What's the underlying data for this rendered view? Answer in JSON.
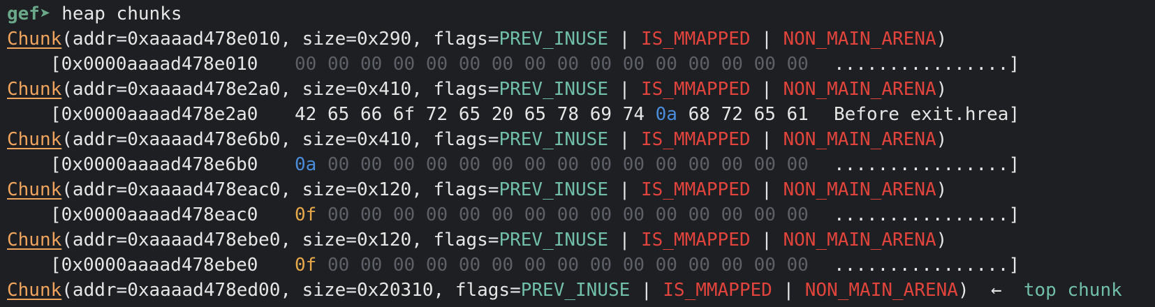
{
  "prompt": "gef➤",
  "command": "heap chunks",
  "chunks": [
    {
      "keyword": "Chunk",
      "addr": "0xaaaad478e010",
      "size": "0x290",
      "flags": [
        "PREV_INUSE",
        "IS_MMAPPED",
        "NON_MAIN_ARENA"
      ],
      "dump_addr": "[0x0000aaaad478e010",
      "bytes": [
        {
          "v": "00",
          "style": "dim"
        },
        {
          "v": "00",
          "style": "dim"
        },
        {
          "v": "00",
          "style": "dim"
        },
        {
          "v": "00",
          "style": "dim"
        },
        {
          "v": "00",
          "style": "dim"
        },
        {
          "v": "00",
          "style": "dim"
        },
        {
          "v": "00",
          "style": "dim"
        },
        {
          "v": "00",
          "style": "dim"
        },
        {
          "v": "00",
          "style": "dim"
        },
        {
          "v": "00",
          "style": "dim"
        },
        {
          "v": "00",
          "style": "dim"
        },
        {
          "v": "00",
          "style": "dim"
        },
        {
          "v": "00",
          "style": "dim"
        },
        {
          "v": "00",
          "style": "dim"
        },
        {
          "v": "00",
          "style": "dim"
        },
        {
          "v": "00",
          "style": "dim"
        }
      ],
      "ascii": "................]"
    },
    {
      "keyword": "Chunk",
      "addr": "0xaaaad478e2a0",
      "size": "0x410",
      "flags": [
        "PREV_INUSE",
        "IS_MMAPPED",
        "NON_MAIN_ARENA"
      ],
      "dump_addr": "[0x0000aaaad478e2a0",
      "bytes": [
        {
          "v": "42",
          "style": "txt"
        },
        {
          "v": "65",
          "style": "txt"
        },
        {
          "v": "66",
          "style": "txt"
        },
        {
          "v": "6f",
          "style": "txt"
        },
        {
          "v": "72",
          "style": "txt"
        },
        {
          "v": "65",
          "style": "txt"
        },
        {
          "v": "20",
          "style": "txt"
        },
        {
          "v": "65",
          "style": "txt"
        },
        {
          "v": "78",
          "style": "txt"
        },
        {
          "v": "69",
          "style": "txt"
        },
        {
          "v": "74",
          "style": "txt"
        },
        {
          "v": "0a",
          "style": "hl-blue"
        },
        {
          "v": "68",
          "style": "txt"
        },
        {
          "v": "72",
          "style": "txt"
        },
        {
          "v": "65",
          "style": "txt"
        },
        {
          "v": "61",
          "style": "txt"
        }
      ],
      "ascii": "Before exit.hrea]"
    },
    {
      "keyword": "Chunk",
      "addr": "0xaaaad478e6b0",
      "size": "0x410",
      "flags": [
        "PREV_INUSE",
        "IS_MMAPPED",
        "NON_MAIN_ARENA"
      ],
      "dump_addr": "[0x0000aaaad478e6b0",
      "bytes": [
        {
          "v": "0a",
          "style": "hl-blue"
        },
        {
          "v": "00",
          "style": "dim"
        },
        {
          "v": "00",
          "style": "dim"
        },
        {
          "v": "00",
          "style": "dim"
        },
        {
          "v": "00",
          "style": "dim"
        },
        {
          "v": "00",
          "style": "dim"
        },
        {
          "v": "00",
          "style": "dim"
        },
        {
          "v": "00",
          "style": "dim"
        },
        {
          "v": "00",
          "style": "dim"
        },
        {
          "v": "00",
          "style": "dim"
        },
        {
          "v": "00",
          "style": "dim"
        },
        {
          "v": "00",
          "style": "dim"
        },
        {
          "v": "00",
          "style": "dim"
        },
        {
          "v": "00",
          "style": "dim"
        },
        {
          "v": "00",
          "style": "dim"
        },
        {
          "v": "00",
          "style": "dim"
        }
      ],
      "ascii": "................]"
    },
    {
      "keyword": "Chunk",
      "addr": "0xaaaad478eac0",
      "size": "0x120",
      "flags": [
        "PREV_INUSE",
        "IS_MMAPPED",
        "NON_MAIN_ARENA"
      ],
      "dump_addr": "[0x0000aaaad478eac0",
      "bytes": [
        {
          "v": "0f",
          "style": "hl-orange"
        },
        {
          "v": "00",
          "style": "dim"
        },
        {
          "v": "00",
          "style": "dim"
        },
        {
          "v": "00",
          "style": "dim"
        },
        {
          "v": "00",
          "style": "dim"
        },
        {
          "v": "00",
          "style": "dim"
        },
        {
          "v": "00",
          "style": "dim"
        },
        {
          "v": "00",
          "style": "dim"
        },
        {
          "v": "00",
          "style": "dim"
        },
        {
          "v": "00",
          "style": "dim"
        },
        {
          "v": "00",
          "style": "dim"
        },
        {
          "v": "00",
          "style": "dim"
        },
        {
          "v": "00",
          "style": "dim"
        },
        {
          "v": "00",
          "style": "dim"
        },
        {
          "v": "00",
          "style": "dim"
        },
        {
          "v": "00",
          "style": "dim"
        }
      ],
      "ascii": "................]"
    },
    {
      "keyword": "Chunk",
      "addr": "0xaaaad478ebe0",
      "size": "0x120",
      "flags": [
        "PREV_INUSE",
        "IS_MMAPPED",
        "NON_MAIN_ARENA"
      ],
      "dump_addr": "[0x0000aaaad478ebe0",
      "bytes": [
        {
          "v": "0f",
          "style": "hl-orange"
        },
        {
          "v": "00",
          "style": "dim"
        },
        {
          "v": "00",
          "style": "dim"
        },
        {
          "v": "00",
          "style": "dim"
        },
        {
          "v": "00",
          "style": "dim"
        },
        {
          "v": "00",
          "style": "dim"
        },
        {
          "v": "00",
          "style": "dim"
        },
        {
          "v": "00",
          "style": "dim"
        },
        {
          "v": "00",
          "style": "dim"
        },
        {
          "v": "00",
          "style": "dim"
        },
        {
          "v": "00",
          "style": "dim"
        },
        {
          "v": "00",
          "style": "dim"
        },
        {
          "v": "00",
          "style": "dim"
        },
        {
          "v": "00",
          "style": "dim"
        },
        {
          "v": "00",
          "style": "dim"
        },
        {
          "v": "00",
          "style": "dim"
        }
      ],
      "ascii": "................]"
    }
  ],
  "top": {
    "keyword": "Chunk",
    "addr": "0xaaaad478ed00",
    "size": "0x20310",
    "flags": [
      "PREV_INUSE",
      "IS_MMAPPED",
      "NON_MAIN_ARENA"
    ],
    "arrow": "←",
    "label": "top chunk"
  },
  "colors": {
    "background": "#1d1f23",
    "prompt": "#6aa889",
    "chunk_keyword": "#f0a45d",
    "flag_prev_inuse": "#72bfa8",
    "flag_red": "#e0443c",
    "dim_byte": "#5d6066",
    "newline_byte": "#4a8ddb",
    "nonzero_byte": "#e7a94a"
  }
}
